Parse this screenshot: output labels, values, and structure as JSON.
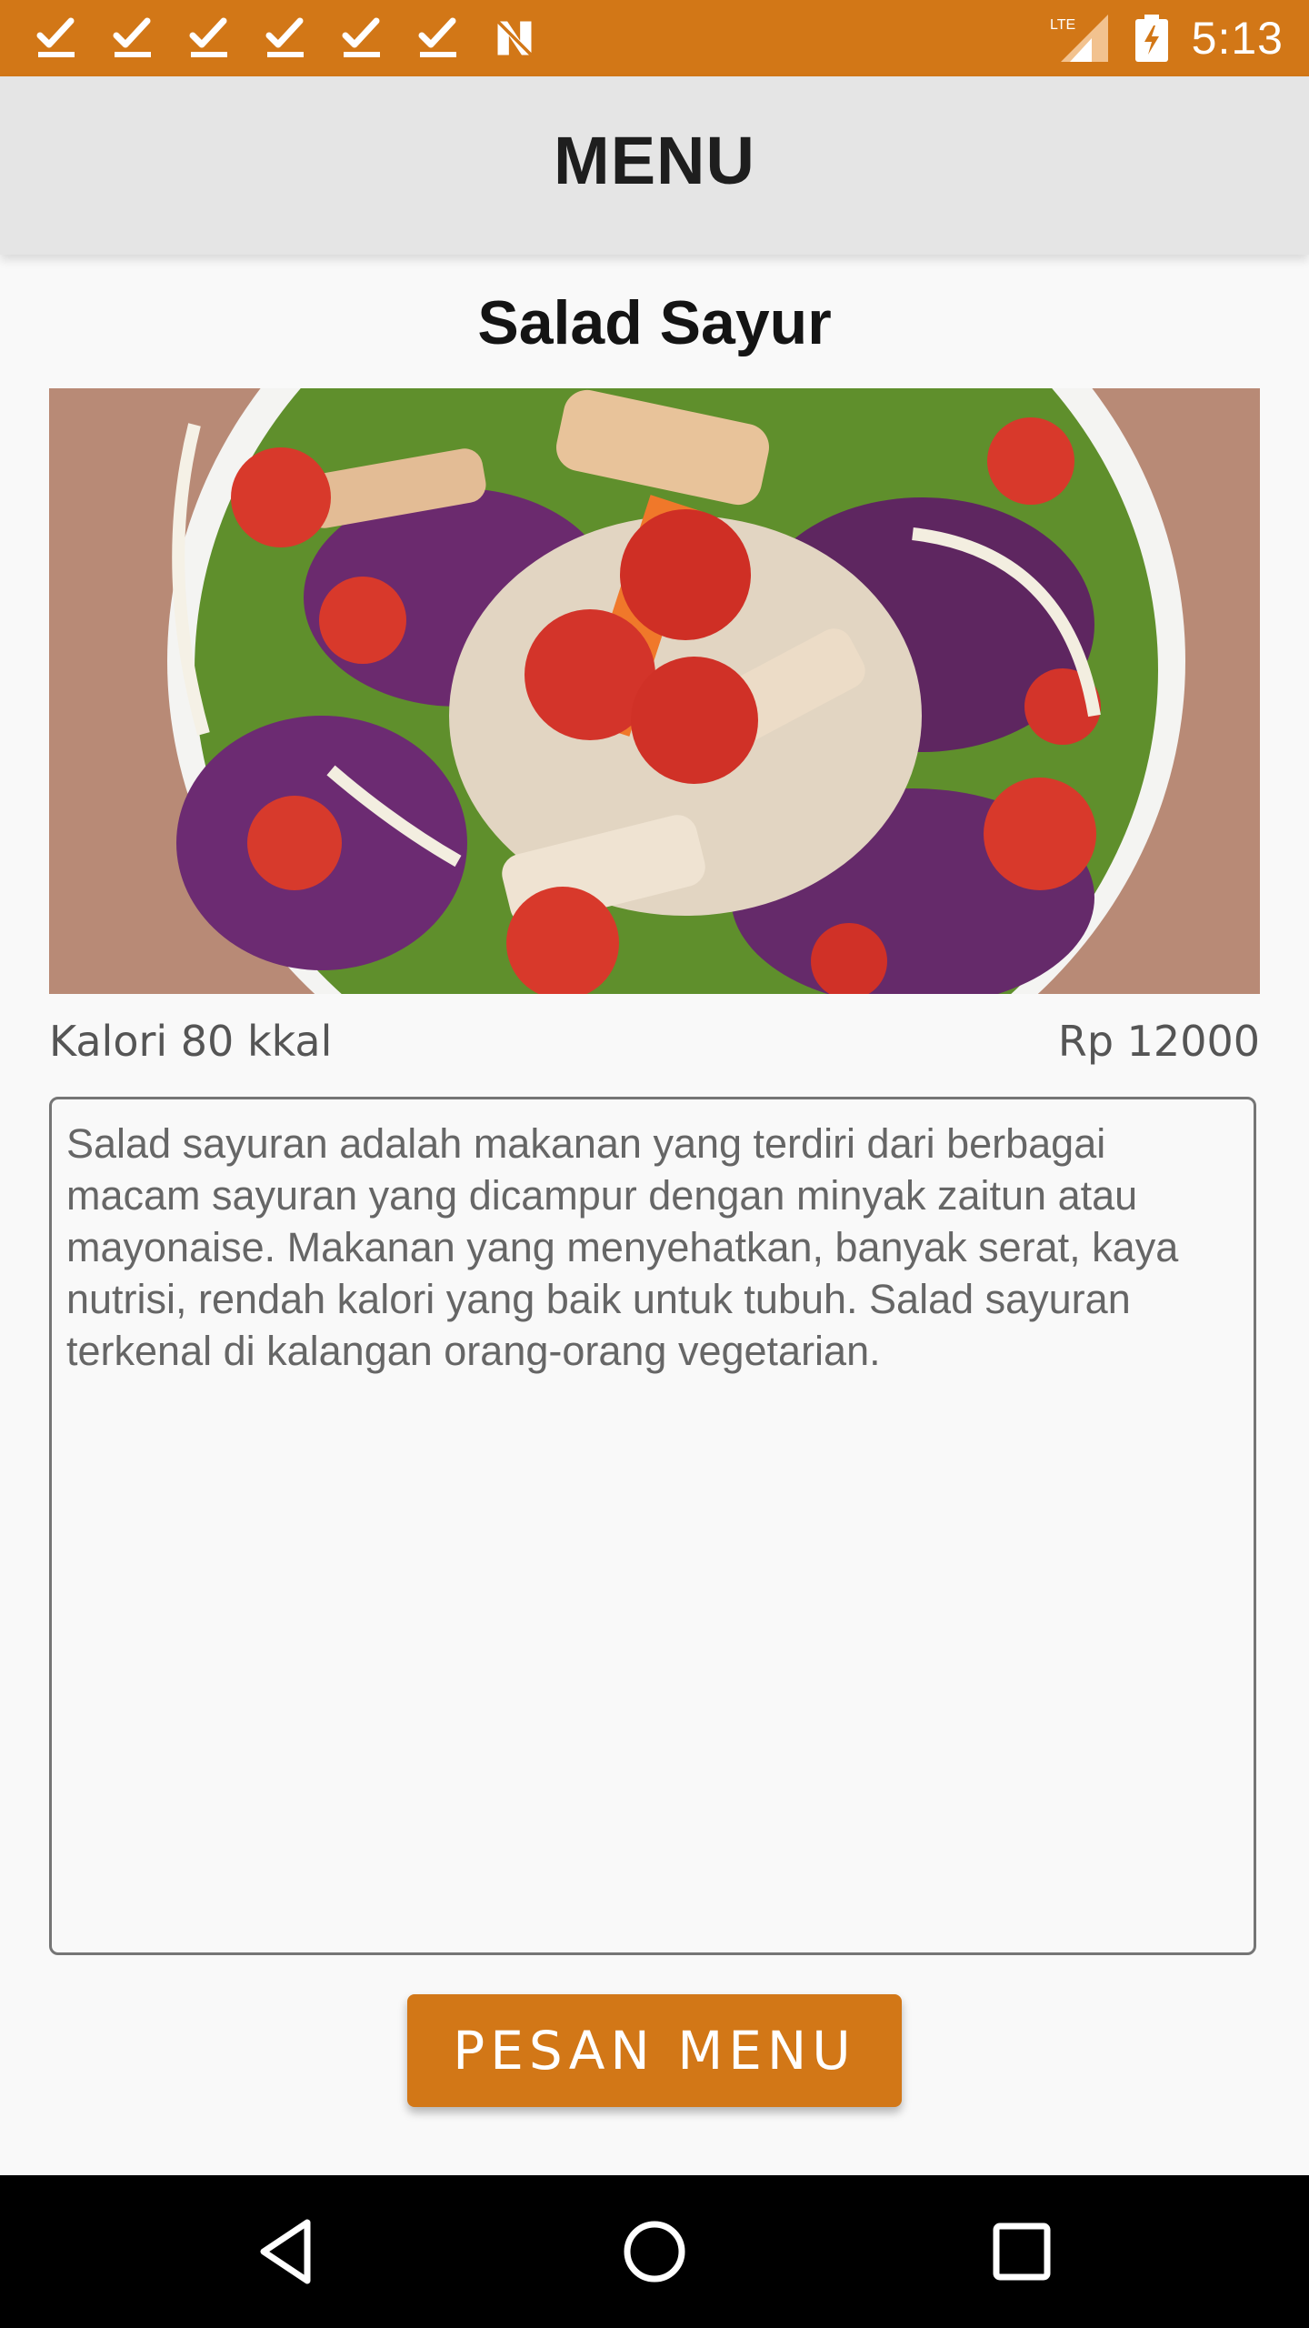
{
  "status_bar": {
    "notification_icons": [
      "check-download-icon",
      "check-download-icon",
      "check-download-icon",
      "check-download-icon",
      "check-download-icon",
      "check-download-icon",
      "n-logo-icon"
    ],
    "network_label": "LTE",
    "time": "5:13"
  },
  "app_bar": {
    "title": "MENU"
  },
  "menu": {
    "name": "Salad Sayur",
    "calories": "Kalori 80 kkal",
    "price": "Rp 12000",
    "description": "Salad sayuran adalah makanan yang terdiri dari berbagai macam sayuran yang dicampur dengan minyak zaitun atau mayonaise. Makanan yang menyehatkan, banyak serat, kaya nutrisi, rendah kalori yang baik untuk tubuh. Salad sayuran terkenal di kalangan orang-orang vegetarian.",
    "order_button_label": "PESAN MENU"
  },
  "navigation": {
    "buttons": [
      "back-icon",
      "home-icon",
      "recents-icon"
    ]
  },
  "colors": {
    "accent": "#d27717",
    "app_bar": "#e5e5e5",
    "background": "#f9f9f9",
    "nav_bar": "#000000"
  }
}
